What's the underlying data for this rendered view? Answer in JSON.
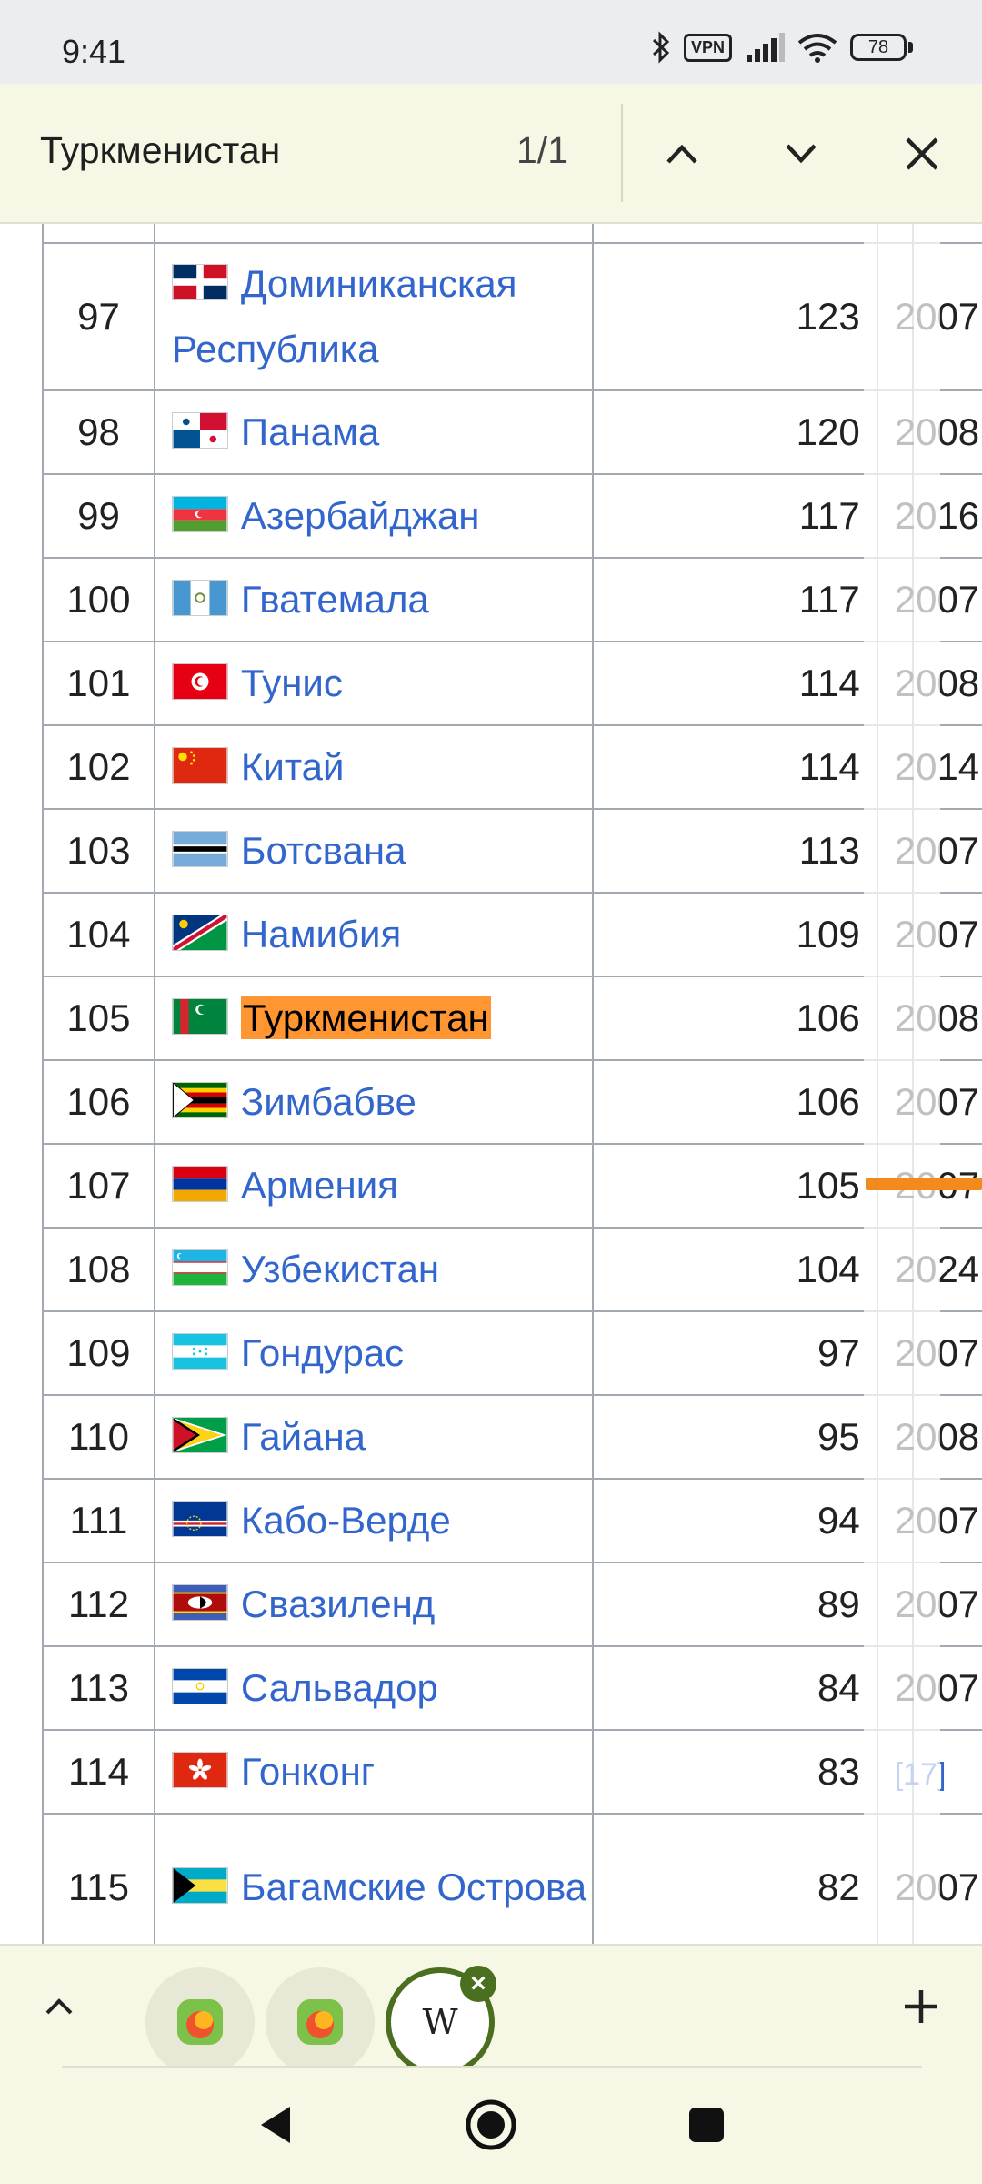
{
  "status_bar": {
    "time": "9:41",
    "vpn": "VPN",
    "battery": "78"
  },
  "find_bar": {
    "query": "Туркменистан",
    "count": "1/1"
  },
  "table": {
    "rows": [
      {
        "rank": "97",
        "country": "Доминиканская Республика",
        "value": "123",
        "year": "2007",
        "flag": "dominican-republic-flag"
      },
      {
        "rank": "98",
        "country": "Панама",
        "value": "120",
        "year": "2008",
        "flag": "panama-flag"
      },
      {
        "rank": "99",
        "country": "Азербайджан",
        "value": "117",
        "year": "2016",
        "flag": "azerbaijan-flag"
      },
      {
        "rank": "100",
        "country": "Гватемала",
        "value": "117",
        "year": "2007",
        "flag": "guatemala-flag"
      },
      {
        "rank": "101",
        "country": "Тунис",
        "value": "114",
        "year": "2008",
        "flag": "tunisia-flag"
      },
      {
        "rank": "102",
        "country": "Китай",
        "value": "114",
        "year": "2014",
        "flag": "china-flag"
      },
      {
        "rank": "103",
        "country": "Ботсвана",
        "value": "113",
        "year": "2007",
        "flag": "botswana-flag"
      },
      {
        "rank": "104",
        "country": "Намибия",
        "value": "109",
        "year": "2007",
        "flag": "namibia-flag"
      },
      {
        "rank": "105",
        "country": "Туркменистан",
        "value": "106",
        "year": "2008",
        "flag": "turkmenistan-flag",
        "highlight": true
      },
      {
        "rank": "106",
        "country": "Зимбабве",
        "value": "106",
        "year": "2007",
        "flag": "zimbabwe-flag"
      },
      {
        "rank": "107",
        "country": "Армения",
        "value": "105",
        "year": "2007",
        "flag": "armenia-flag"
      },
      {
        "rank": "108",
        "country": "Узбекистан",
        "value": "104",
        "year": "2024",
        "flag": "uzbekistan-flag"
      },
      {
        "rank": "109",
        "country": "Гондурас",
        "value": "97",
        "year": "2007",
        "flag": "honduras-flag"
      },
      {
        "rank": "110",
        "country": "Гайана",
        "value": "95",
        "year": "2008",
        "flag": "guyana-flag"
      },
      {
        "rank": "111",
        "country": "Кабо-Верде",
        "value": "94",
        "year": "2007",
        "flag": "cape-verde-flag"
      },
      {
        "rank": "112",
        "country": "Свазиленд",
        "value": "89",
        "year": "2007",
        "flag": "eswatini-flag"
      },
      {
        "rank": "113",
        "country": "Сальвадор",
        "value": "84",
        "year": "2007",
        "flag": "el-salvador-flag"
      },
      {
        "rank": "114",
        "country": "Гонконг",
        "value": "83",
        "year": "[17]",
        "flag": "hong-kong-flag"
      },
      {
        "rank": "115",
        "country": "Багамские Острова",
        "value": "82",
        "year": "2007",
        "flag": "bahamas-flag"
      }
    ]
  },
  "tabs": {
    "items": [
      {
        "icon": "orange-app-icon"
      },
      {
        "icon": "orange-app-icon"
      },
      {
        "icon": "wikipedia-icon",
        "glyph": "W",
        "active": true
      }
    ]
  },
  "colors": {
    "accent": "#4a6f1e",
    "highlight": "#ff9632",
    "link": "#3366cc",
    "chrome_bg": "#f7f7e6"
  }
}
